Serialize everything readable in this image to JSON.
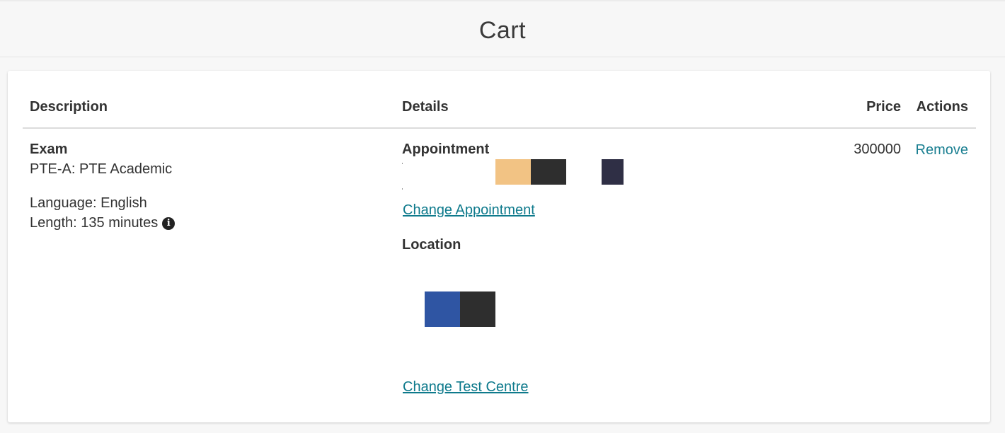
{
  "header": {
    "title": "Cart"
  },
  "table": {
    "columns": [
      "Description",
      "Details",
      "Price",
      "Actions"
    ],
    "rows": [
      {
        "description": {
          "title": "Exam",
          "name": "PTE-A: PTE Academic",
          "language": "Language: English",
          "length": "Length: 135 minutes",
          "length_icon": "info-icon"
        },
        "details": {
          "appointment_label": "Appointment",
          "change_appointment": "Change Appointment",
          "location_label": "Location",
          "change_test_centre": "Change Test Centre"
        },
        "price": "300000",
        "action": "Remove"
      }
    ]
  },
  "colors": {
    "link": "#0e7a8c",
    "text": "#333333",
    "background": "#f7f7f7"
  }
}
